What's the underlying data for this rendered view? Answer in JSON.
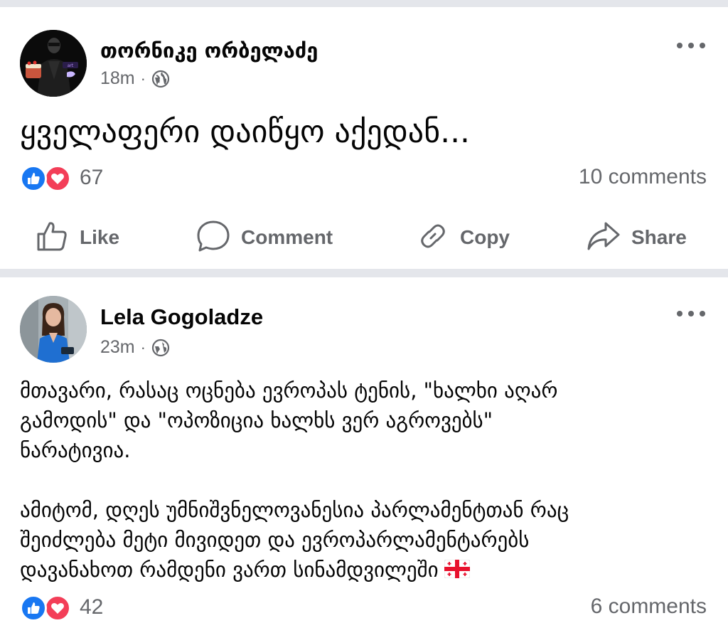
{
  "posts": [
    {
      "author": "თორნიკე ორბელაძე",
      "time": "18m",
      "separator": "·",
      "audience_icon": "globe-icon",
      "text": "ყველაფერი დაიწყო აქედან...",
      "reaction_types": [
        "like",
        "love"
      ],
      "reaction_count": "67",
      "comments": "10 comments",
      "actions": {
        "like": "Like",
        "comment": "Comment",
        "copy": "Copy",
        "share": "Share"
      }
    },
    {
      "author": "Lela Gogoladze",
      "time": "23m",
      "separator": "·",
      "audience_icon": "globe-icon",
      "paragraphs": [
        "მთავარი, რასაც ოცნება ევროპას ტენის, \"ხალხი აღარ\nგამოდის\" და \"ოპოზიცია ხალხს ვერ აგროვებს\"\nნარატივია.",
        "ამიტომ, დღეს უმნიშვნელოვანესია პარლამენტთან რაც\nშეიძლება მეტი მივიდეთ და ევროპარლამენტარებს\nდავანახოთ რამდენი ვართ სინამდვილეში"
      ],
      "flag_icon": "georgia-flag-icon",
      "reaction_types": [
        "like",
        "love"
      ],
      "reaction_count": "42",
      "comments": "6 comments"
    }
  ],
  "colors": {
    "like_blue": "#1877f2",
    "love_red": "#f33e58",
    "secondary_text": "#65676b",
    "divider": "#e4e6eb"
  }
}
